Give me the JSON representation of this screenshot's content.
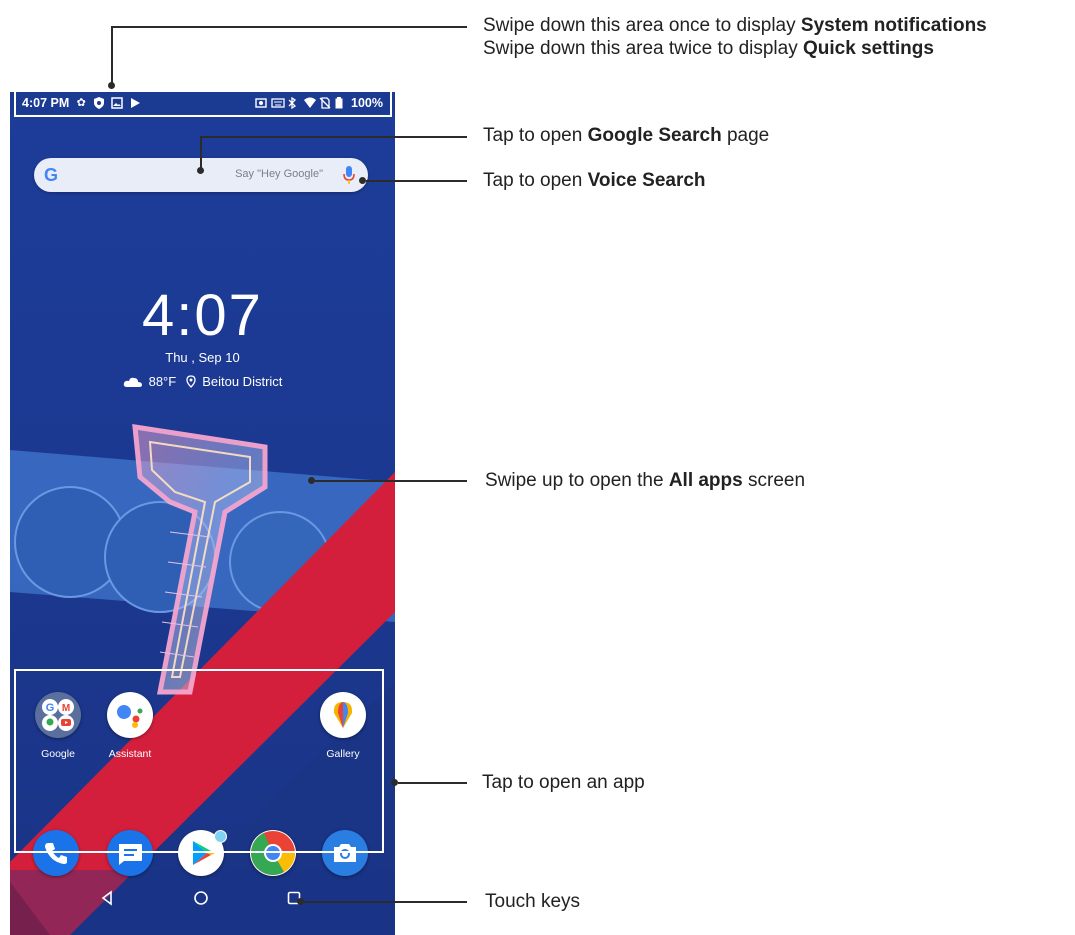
{
  "status_bar": {
    "time": "4:07 PM",
    "battery": "100%"
  },
  "search": {
    "logo": "G",
    "placeholder": "Say \"Hey Google\""
  },
  "clock": {
    "time": "4:07",
    "date": "Thu , Sep 10",
    "temperature": "88°F",
    "location": "Beitou District"
  },
  "apps": [
    {
      "label": "Google",
      "icon": "google-folder-icon"
    },
    {
      "label": "Assistant",
      "icon": "assistant-icon"
    },
    {
      "label": "Gallery",
      "icon": "gallery-icon"
    }
  ],
  "dock": [
    {
      "name": "phone",
      "icon": "phone-icon",
      "color": "#1a73e8"
    },
    {
      "name": "messages",
      "icon": "messages-icon",
      "color": "#1a73e8"
    },
    {
      "name": "play-store",
      "icon": "play-store-icon",
      "color": "#ffffff"
    },
    {
      "name": "chrome",
      "icon": "chrome-icon",
      "color": "#ffffff"
    },
    {
      "name": "camera",
      "icon": "camera-icon",
      "color": "#2a7de1"
    }
  ],
  "nav_keys": [
    "back-icon",
    "home-icon",
    "recents-icon"
  ],
  "callouts": {
    "notifications": {
      "line1_prefix": "Swipe down this area once to display ",
      "line1_bold": "System notifications",
      "line2_prefix": "Swipe down this area twice to display ",
      "line2_bold": "Quick settings"
    },
    "google_search": {
      "prefix": "Tap to open ",
      "bold": "Google Search",
      "suffix": " page"
    },
    "voice_search": {
      "prefix": "Tap to open ",
      "bold": "Voice Search"
    },
    "all_apps": {
      "prefix": "Swipe up to open the ",
      "bold": "All apps",
      "suffix": " screen"
    },
    "open_app": {
      "text": "Tap to open an app"
    },
    "touch_keys": {
      "text": "Touch keys"
    }
  },
  "colors": {
    "wallpaper_blue": "#1f3e98",
    "wallpaper_red": "#d31f3c",
    "accent": "#4285f4"
  }
}
